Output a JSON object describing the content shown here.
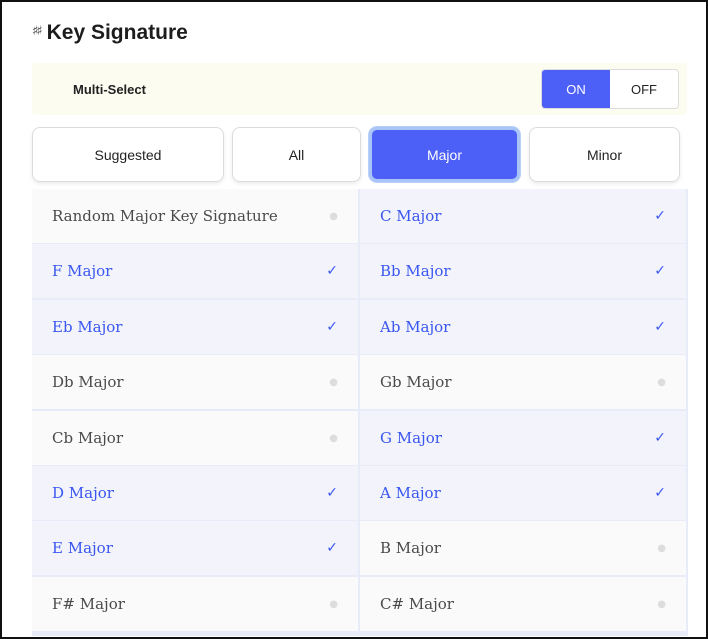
{
  "header": {
    "icon": "sharp-signature-icon",
    "icon_glyph": "♯♯",
    "title": "Key Signature"
  },
  "multi_select": {
    "label": "Multi-Select",
    "on_label": "ON",
    "off_label": "OFF",
    "state": "ON"
  },
  "tabs": [
    {
      "label": "Suggested",
      "active": false
    },
    {
      "label": "All",
      "active": false
    },
    {
      "label": "Major",
      "active": true
    },
    {
      "label": "Minor",
      "active": false
    }
  ],
  "marks": {
    "selected": "✓",
    "unselected": "●"
  },
  "keys": [
    {
      "label": "Random Major Key Signature",
      "selected": false
    },
    {
      "label": "C Major",
      "selected": true
    },
    {
      "label": "F Major",
      "selected": true
    },
    {
      "label": "Bb Major",
      "selected": true
    },
    {
      "label": "Eb Major",
      "selected": true
    },
    {
      "label": "Ab Major",
      "selected": true
    },
    {
      "label": "Db Major",
      "selected": false
    },
    {
      "label": "Gb Major",
      "selected": false
    },
    {
      "label": "Cb Major",
      "selected": false
    },
    {
      "label": "G Major",
      "selected": true
    },
    {
      "label": "D Major",
      "selected": true
    },
    {
      "label": "A Major",
      "selected": true
    },
    {
      "label": "E Major",
      "selected": true
    },
    {
      "label": "B Major",
      "selected": false
    },
    {
      "label": "F# Major",
      "selected": false
    },
    {
      "label": "C# Major",
      "selected": false
    }
  ],
  "colors": {
    "accent": "#4c5ff7",
    "selected_text": "#3a56f0",
    "banner": "#fcfcf0"
  }
}
